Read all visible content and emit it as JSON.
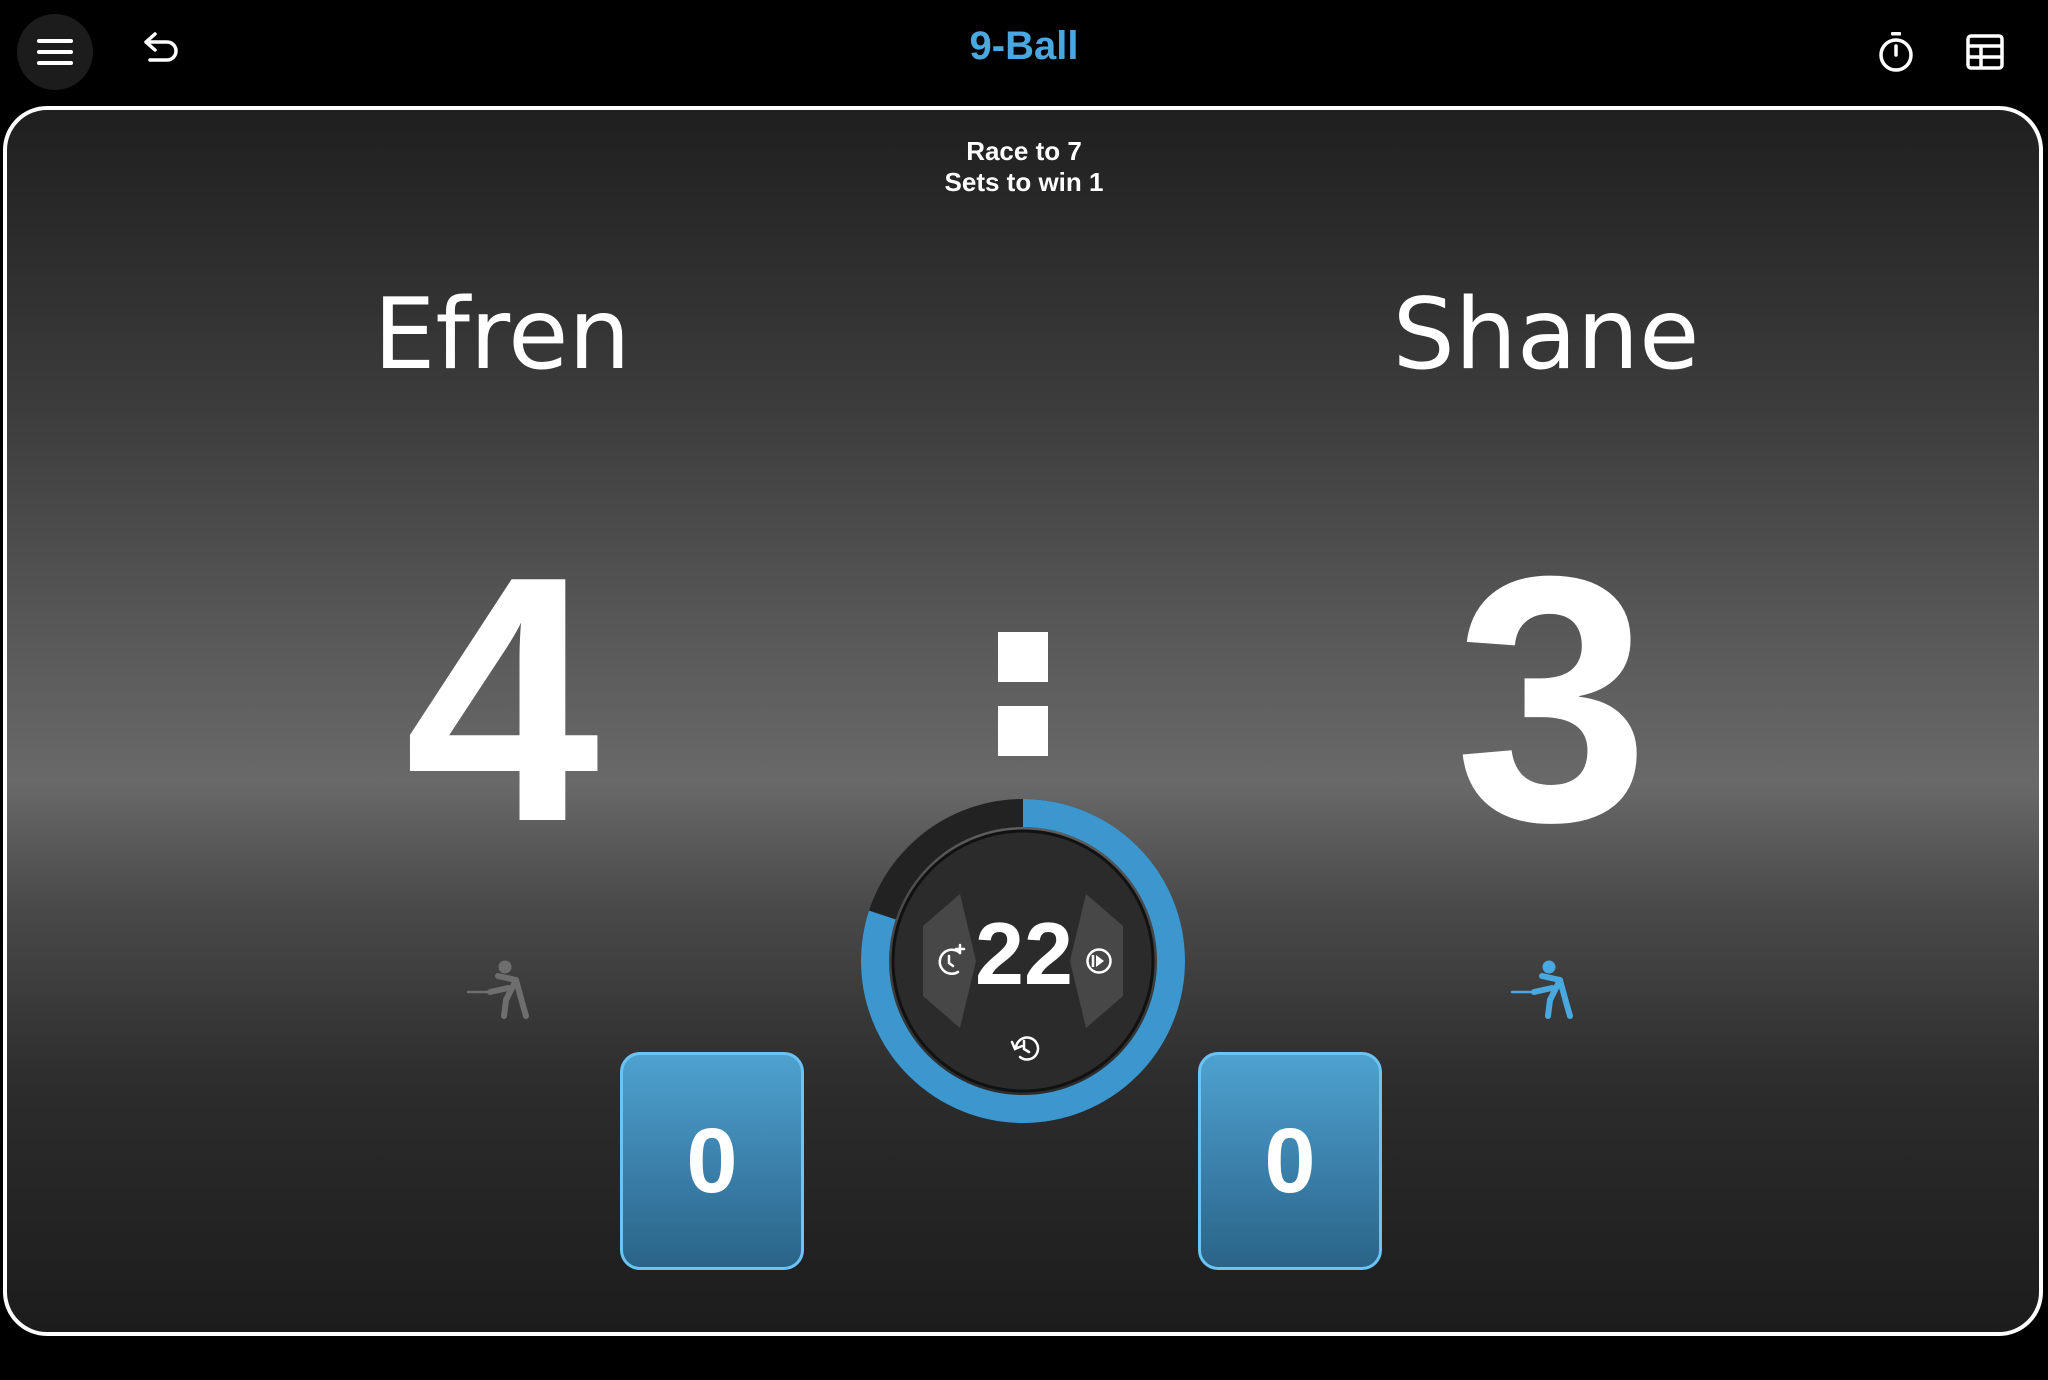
{
  "header": {
    "title": "9-Ball",
    "menu_icon": "hamburger-menu-icon",
    "undo_icon": "undo-icon",
    "timer_icon": "stopwatch-icon",
    "table_icon": "table-icon",
    "title_color": "#4aa8e0"
  },
  "match": {
    "race_to": "Race to 7",
    "sets_to_win": "Sets to win 1"
  },
  "players": [
    {
      "name": "Efren",
      "score": "4",
      "extensions": "0",
      "active": false,
      "shooter_color": "#6e6e6e"
    },
    {
      "name": "Shane",
      "score": "3",
      "extensions": "0",
      "active": true,
      "shooter_color": "#4aa8e0"
    }
  ],
  "shot_clock": {
    "value": "22",
    "progress": 0.8,
    "accent": "#3c97cf",
    "add_time_icon": "add-time-icon",
    "start_icon": "play-circle-icon",
    "reset_icon": "reset-history-icon"
  }
}
